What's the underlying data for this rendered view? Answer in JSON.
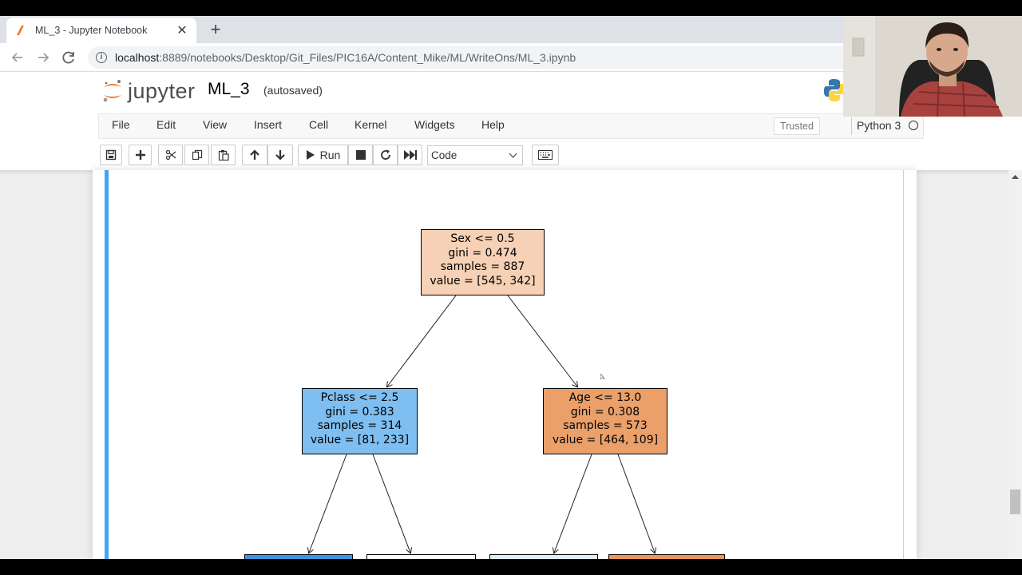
{
  "browser": {
    "tab_title": "ML_3 - Jupyter Notebook",
    "tab_close": "✕",
    "new_tab": "+",
    "url_host": "localhost",
    "url_path": ":8889/notebooks/Desktop/Git_Files/PIC16A/Content_Mike/ML/WriteOns/ML_3.ipynb"
  },
  "jupyter": {
    "logo_text": "jupyter",
    "notebook_name": "ML_3",
    "save_status": "(autosaved)",
    "trusted": "Trusted",
    "kernel": "Python 3"
  },
  "menu": {
    "items": [
      "File",
      "Edit",
      "View",
      "Insert",
      "Cell",
      "Kernel",
      "Widgets",
      "Help"
    ]
  },
  "toolbar": {
    "run_label": "Run",
    "cell_type": "Code"
  },
  "tree": {
    "root": {
      "lines": [
        "Sex <= 0.5",
        "gini = 0.474",
        "samples = 887",
        "value = [545, 342]"
      ],
      "fill": "#f6d1b5"
    },
    "left": {
      "lines": [
        "Pclass <= 2.5",
        "gini = 0.383",
        "samples = 314",
        "value = [81, 233]"
      ],
      "fill": "#7ebef0"
    },
    "right": {
      "lines": [
        "Age <= 13.0",
        "gini = 0.308",
        "samples = 573",
        "value = [464, 109]"
      ],
      "fill": "#eba06a"
    },
    "leaf_fills": [
      "#3c95e0",
      "#ffffff",
      "#deeefa",
      "#e9965a"
    ]
  },
  "colors": {
    "cell_selected": "#42a5f5",
    "jupyter_orange": "#f37726"
  }
}
